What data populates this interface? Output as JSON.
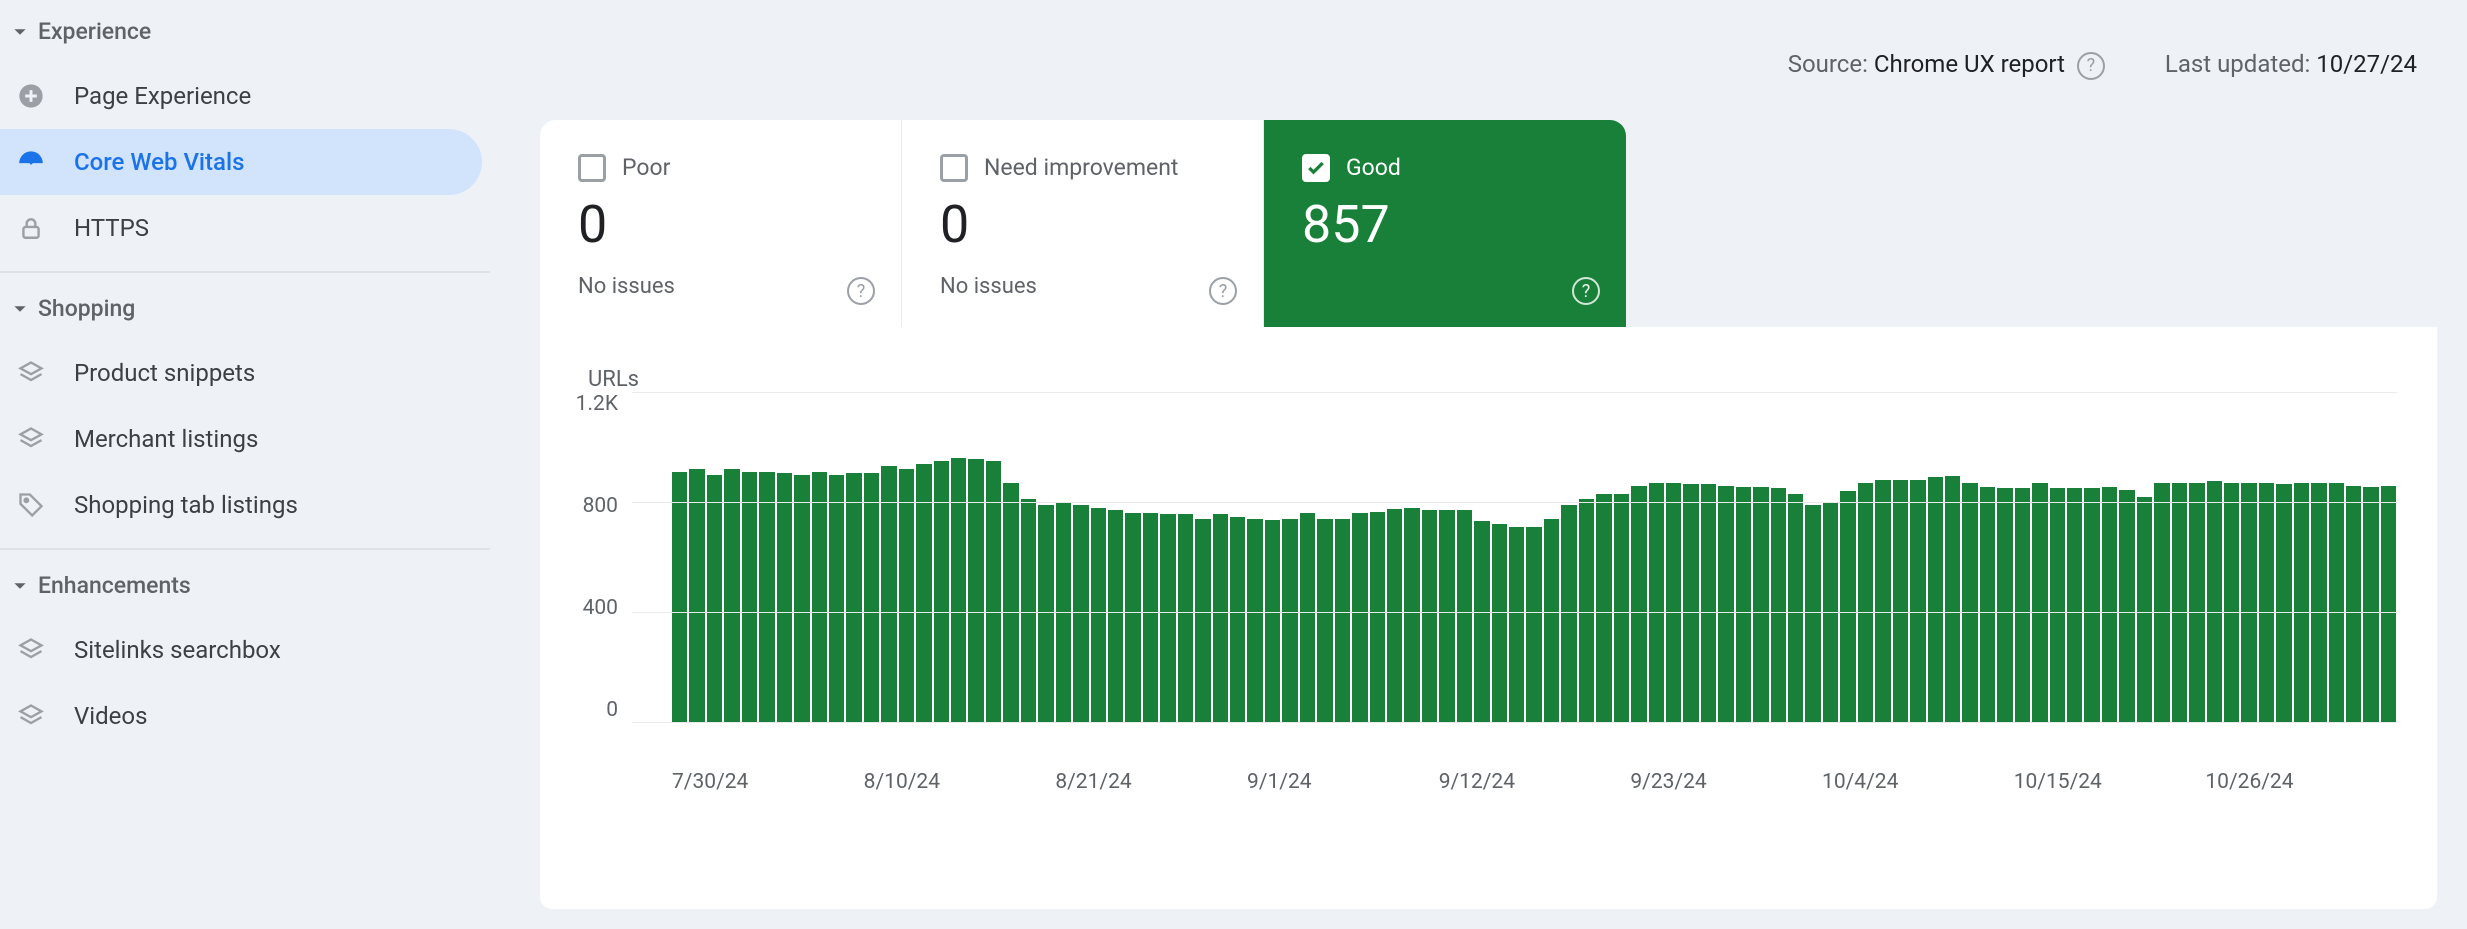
{
  "sidebar": {
    "sections": [
      {
        "label": "Experience",
        "items": [
          {
            "label": "Page Experience",
            "icon": "plus-circle"
          },
          {
            "label": "Core Web Vitals",
            "icon": "speed",
            "active": true
          },
          {
            "label": "HTTPS",
            "icon": "lock"
          }
        ]
      },
      {
        "label": "Shopping",
        "items": [
          {
            "label": "Product snippets",
            "icon": "layers"
          },
          {
            "label": "Merchant listings",
            "icon": "layers"
          },
          {
            "label": "Shopping tab listings",
            "icon": "tag"
          }
        ]
      },
      {
        "label": "Enhancements",
        "items": [
          {
            "label": "Sitelinks searchbox",
            "icon": "layers"
          },
          {
            "label": "Videos",
            "icon": "layers"
          }
        ]
      }
    ]
  },
  "meta": {
    "source_label": "Source: ",
    "source_value": "Chrome UX report",
    "updated_label": "Last updated: ",
    "updated_value": "10/27/24"
  },
  "cards": {
    "poor": {
      "label": "Poor",
      "count": "0",
      "sub": "No issues",
      "checked": false
    },
    "need": {
      "label": "Need improvement",
      "count": "0",
      "sub": "No issues",
      "checked": false
    },
    "good": {
      "label": "Good",
      "count": "857",
      "sub": "",
      "checked": true
    }
  },
  "chart_data": {
    "type": "bar",
    "title": "URLs",
    "ylabel": "",
    "xlabel": "",
    "ylim": [
      0,
      1200
    ],
    "y_ticks": [
      "1.2K",
      "800",
      "400",
      "0"
    ],
    "x_ticks": [
      "7/30/24",
      "8/10/24",
      "8/21/24",
      "9/1/24",
      "9/12/24",
      "9/23/24",
      "10/4/24",
      "10/15/24",
      "10/26/24"
    ],
    "categories": [
      "7/30/24",
      "7/31/24",
      "8/1/24",
      "8/2/24",
      "8/3/24",
      "8/4/24",
      "8/5/24",
      "8/6/24",
      "8/7/24",
      "8/8/24",
      "8/9/24",
      "8/10/24",
      "8/11/24",
      "8/12/24",
      "8/13/24",
      "8/14/24",
      "8/15/24",
      "8/16/24",
      "8/17/24",
      "8/18/24",
      "8/19/24",
      "8/20/24",
      "8/21/24",
      "8/22/24",
      "8/23/24",
      "8/24/24",
      "8/25/24",
      "8/26/24",
      "8/27/24",
      "8/28/24",
      "8/29/24",
      "8/30/24",
      "8/31/24",
      "9/1/24",
      "9/2/24",
      "9/3/24",
      "9/4/24",
      "9/5/24",
      "9/6/24",
      "9/7/24",
      "9/8/24",
      "9/9/24",
      "9/10/24",
      "9/11/24",
      "9/12/24",
      "9/13/24",
      "9/14/24",
      "9/15/24",
      "9/16/24",
      "9/17/24",
      "9/18/24",
      "9/19/24",
      "9/20/24",
      "9/21/24",
      "9/22/24",
      "9/23/24",
      "9/24/24",
      "9/25/24",
      "9/26/24",
      "9/27/24",
      "9/28/24",
      "9/29/24",
      "9/30/24",
      "10/1/24",
      "10/2/24",
      "10/3/24",
      "10/4/24",
      "10/5/24",
      "10/6/24",
      "10/7/24",
      "10/8/24",
      "10/9/24",
      "10/10/24",
      "10/11/24",
      "10/12/24",
      "10/13/24",
      "10/14/24",
      "10/15/24",
      "10/16/24",
      "10/17/24",
      "10/18/24",
      "10/19/24",
      "10/20/24",
      "10/21/24",
      "10/22/24",
      "10/23/24",
      "10/24/24",
      "10/25/24",
      "10/26/24"
    ],
    "values": [
      910,
      920,
      900,
      920,
      910,
      910,
      905,
      900,
      910,
      900,
      905,
      905,
      930,
      920,
      940,
      950,
      960,
      955,
      950,
      870,
      810,
      790,
      800,
      790,
      780,
      770,
      760,
      760,
      755,
      755,
      740,
      755,
      745,
      740,
      735,
      740,
      760,
      740,
      740,
      760,
      765,
      775,
      780,
      770,
      770,
      770,
      730,
      720,
      710,
      710,
      740,
      790,
      810,
      830,
      830,
      860,
      870,
      870,
      865,
      865,
      860,
      855,
      855,
      850,
      830,
      790,
      800,
      840,
      870,
      880,
      880,
      880,
      890,
      895,
      870,
      855,
      850,
      850,
      870,
      850,
      850,
      850,
      855,
      845,
      820,
      870,
      870,
      870,
      875,
      870,
      870,
      870,
      865,
      870,
      870,
      870,
      860,
      855,
      857
    ],
    "color": "#188038"
  }
}
